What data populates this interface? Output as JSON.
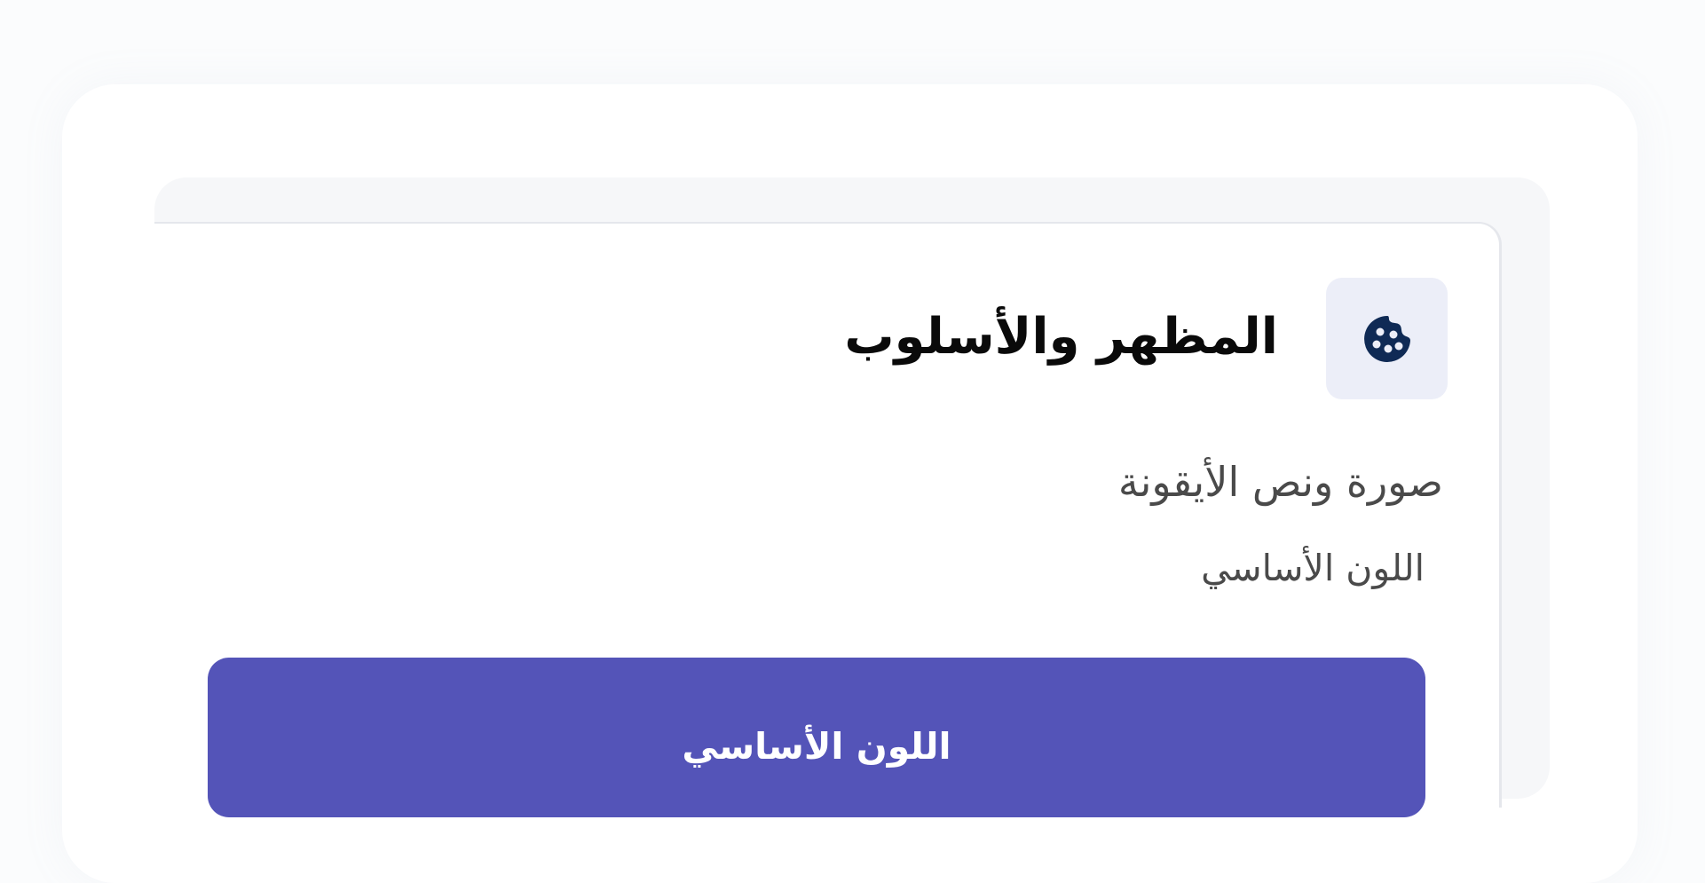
{
  "section": {
    "title": "المظهر والأسلوب",
    "icon": "palette-icon",
    "subtitle": "صورة ونص الأيقونة"
  },
  "primary_color": {
    "label": "اللون الأساسي",
    "button_label": "اللون الأساسي",
    "value": "#5454b8"
  },
  "colors": {
    "icon_color": "#0f2a55",
    "icon_background": "#eceef8",
    "button_background": "#5454b8"
  }
}
